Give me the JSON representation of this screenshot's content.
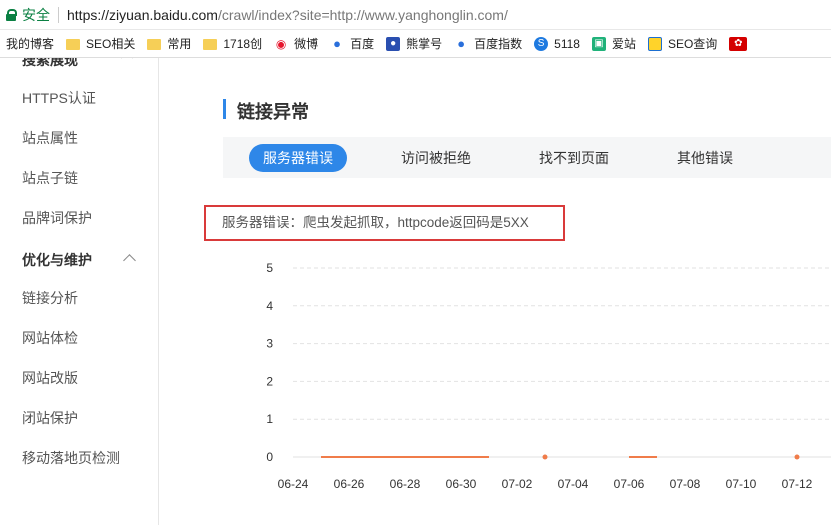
{
  "address_bar": {
    "secure_label": "安全",
    "url_host": "https://ziyuan.baidu.com",
    "url_path": "/crawl/index?site=http://www.yanghonglin.com/"
  },
  "bookmarks": [
    {
      "label": "我的博客",
      "icon": "none"
    },
    {
      "label": "SEO相关",
      "icon": "folder-icon"
    },
    {
      "label": "常用",
      "icon": "folder-icon"
    },
    {
      "label": "1718创",
      "icon": "folder-icon"
    },
    {
      "label": "微博",
      "icon": "weibo-icon"
    },
    {
      "label": "百度",
      "icon": "baidu-paw-icon"
    },
    {
      "label": "熊掌号",
      "icon": "bear-paw-icon"
    },
    {
      "label": "百度指数",
      "icon": "baidu-paw-icon"
    },
    {
      "label": "5118",
      "icon": "5118-icon"
    },
    {
      "label": "爱站",
      "icon": "aizhan-icon"
    },
    {
      "label": "SEO查询",
      "icon": "seo-query-icon"
    }
  ],
  "sidebar": {
    "clipped_group": "搜索展现",
    "items_top": [
      "HTTPS认证",
      "站点属性",
      "站点子链",
      "品牌词保护"
    ],
    "group": "优化与维护",
    "items_bottom": [
      "链接分析",
      "网站体检",
      "网站改版",
      "闭站保护",
      "移动落地页检测"
    ]
  },
  "main": {
    "title": "链接异常",
    "tabs": [
      "服务器错误",
      "访问被拒绝",
      "找不到页面",
      "其他错误"
    ],
    "active_tab": 0,
    "notice": "服务器错误：爬虫发起抓取，httpcode返回码是5XX"
  },
  "chart_data": {
    "type": "line",
    "x_labels": [
      "06-24",
      "06-26",
      "06-28",
      "06-30",
      "07-02",
      "07-04",
      "07-06",
      "07-08",
      "07-10",
      "07-12"
    ],
    "x": [
      "06-25",
      "06-26",
      "06-27",
      "06-28",
      "06-29",
      "06-30",
      "07-01",
      "07-03",
      "07-06",
      "07-07",
      "07-12"
    ],
    "y": [
      0,
      0,
      0,
      0,
      0,
      0,
      0,
      0,
      0,
      0,
      0
    ],
    "ylim": [
      0,
      5
    ],
    "yticks": [
      0,
      1,
      2,
      3,
      4,
      5
    ],
    "grid": true,
    "series_color": "#f07c4a"
  }
}
